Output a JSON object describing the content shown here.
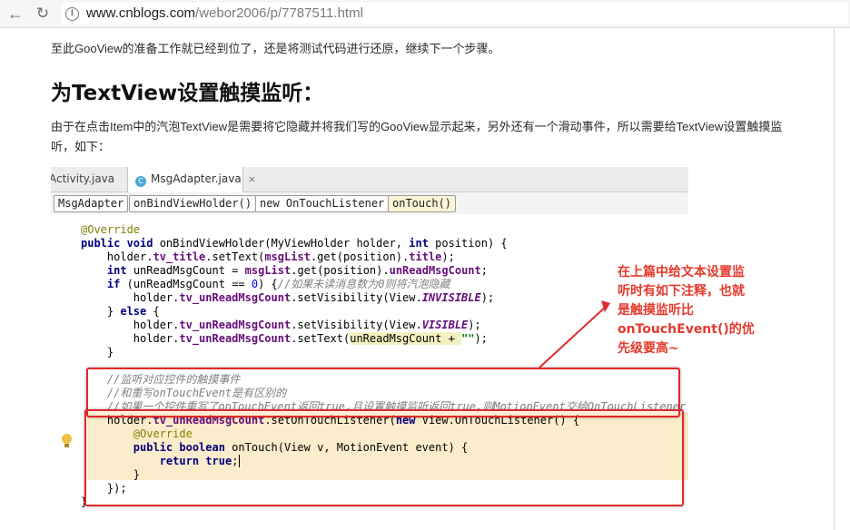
{
  "browser": {
    "url_host": "www.cnblogs.com",
    "url_path": "/webor2006/p/7787511.html",
    "back_icon": "back-arrow-icon",
    "reload_icon": "reload-icon"
  },
  "article": {
    "para1": "至此GooView的准备工作就已经到位了，还是将测试代码进行还原，继续下一个步骤。",
    "heading": "为TextView设置触摸监听：",
    "para2": "由于在点击Item中的汽泡TextView是需要将它隐藏并将我们写的GooView显示起来，另外还有一个滑动事件，所以需要给TextView设置触摸监听，如下："
  },
  "ide": {
    "tabs": [
      "Activity.java",
      "MsgAdapter.java"
    ],
    "tab_icon_letter": "C",
    "tab_close": "×",
    "breadcrumbs": [
      "MsgAdapter",
      "onBindViewHolder()",
      "new OnTouchListener",
      "onTouch()"
    ],
    "code": {
      "l1": "@Override",
      "l2a": "public void ",
      "l2b": "onBindViewHolder(MyViewHolder holder, ",
      "l2c": "int ",
      "l2d": "position) {",
      "l3a": "    holder.",
      "l3b": "tv_title",
      "l3c": ".setText(",
      "l3d": "msgList",
      "l3e": ".get(position).",
      "l3f": "title",
      "l3g": ");",
      "l4a": "    ",
      "l4b": "int ",
      "l4c": "unReadMsgCount = ",
      "l4d": "msgList",
      "l4e": ".get(position).",
      "l4f": "unReadMsgCount",
      "l4g": ";",
      "l5a": "    ",
      "l5b": "if ",
      "l5c": "(unReadMsgCount == ",
      "l5d": "0",
      "l5e": ") {",
      "l5f": "//如果未读消息数为0则将汽泡隐藏",
      "l6a": "        holder.",
      "l6b": "tv_unReadMsgCount",
      "l6c": ".setVisibility(View.",
      "l6d": "INVISIBLE",
      "l6e": ");",
      "l7a": "    } ",
      "l7b": "else ",
      "l7c": "{",
      "l8a": "        holder.",
      "l8b": "tv_unReadMsgCount",
      "l8c": ".setVisibility(View.",
      "l8d": "VISIBLE",
      "l8e": ");",
      "l9a": "        holder.",
      "l9b": "tv_unReadMsgCount",
      "l9c": ".setText(",
      "l9d": "unReadMsgCount + ",
      "l9e": "\"\"",
      "l9f": ");",
      "l10": "    }",
      "l11": "    //监听对应控件的触摸事件",
      "l12a": "    //和重写",
      "l12b": "onTouchEvent",
      "l12c": "是有区别的",
      "l13a": "    //如果一个控件重写了",
      "l13b": "onTouchEvent",
      "l13c": "返回",
      "l13d": "true",
      "l13e": ",且设置触摸监听返回",
      "l13f": "true",
      "l13g": ",则",
      "l13h": "MotionEvent",
      "l13i": "交给",
      "l13j": "OnTouchListener",
      "l14a": "    holder.",
      "l14b": "tv_unReadMsgCount",
      "l14c": ".setOnTouchListener(",
      "l14d": "new ",
      "l14e": "View.OnTouchListener() {",
      "l15": "        @Override",
      "l16a": "        ",
      "l16b": "public boolean ",
      "l16c": "onTouch(View v, MotionEvent event) {",
      "l17a": "            ",
      "l17b": "return true",
      "l17c": ";",
      "l18": "        }",
      "l19": "    });",
      "l20": "}"
    }
  },
  "annotation": {
    "lines": [
      "在上篇中给文本设置监",
      "听时有如下注释，也就",
      "是触摸监听比",
      "onTouchEvent()的优",
      "先级要高~"
    ],
    "color": "#e53a2c"
  }
}
